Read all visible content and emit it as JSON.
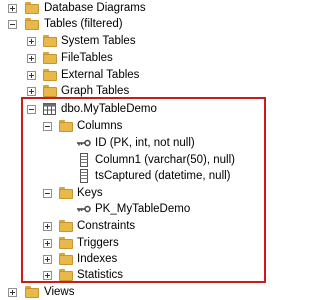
{
  "tree": {
    "database_diagrams": "Database Diagrams",
    "tables": "Tables (filtered)",
    "system_tables": "System Tables",
    "file_tables": "FileTables",
    "external_tables": "External Tables",
    "graph_tables": "Graph Tables",
    "table": "dbo.MyTableDemo",
    "columns": "Columns",
    "column_id": "ID (PK, int, not null)",
    "column_1": "Column1 (varchar(50), null)",
    "column_ts": "tsCaptured (datetime, null)",
    "keys": "Keys",
    "pk": "PK_MyTableDemo",
    "constraints": "Constraints",
    "triggers": "Triggers",
    "indexes": "Indexes",
    "statistics": "Statistics",
    "views": "Views"
  },
  "colors": {
    "highlight": "#cc1b1b",
    "folder": "#e8b94a"
  }
}
